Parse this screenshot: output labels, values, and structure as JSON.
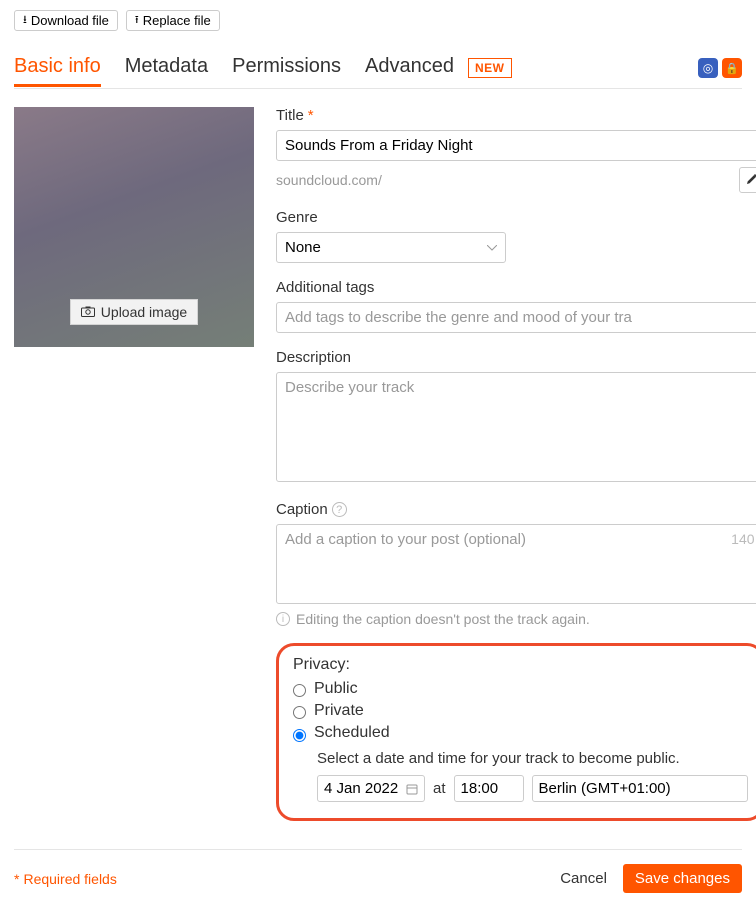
{
  "toolbar": {
    "download": "Download file",
    "replace": "Replace file"
  },
  "tabs": {
    "basic": "Basic info",
    "metadata": "Metadata",
    "permissions": "Permissions",
    "advanced": "Advanced",
    "new_badge": "NEW"
  },
  "artwork": {
    "upload_label": "Upload image"
  },
  "fields": {
    "title_label": "Title",
    "title_value": "Sounds From a Friday Night",
    "url_prefix": "soundcloud.com/",
    "genre_label": "Genre",
    "genre_value": "None",
    "tags_label": "Additional tags",
    "tags_placeholder": "Add tags to describe the genre and mood of your tra",
    "desc_label": "Description",
    "desc_placeholder": "Describe your track",
    "caption_label": "Caption",
    "caption_placeholder": "Add a caption to your post (optional)",
    "caption_count": "140",
    "caption_hint": "Editing the caption doesn't post the track again."
  },
  "privacy": {
    "label": "Privacy:",
    "public": "Public",
    "private": "Private",
    "scheduled": "Scheduled",
    "scheduled_hint": "Select a date and time for your track to become public.",
    "date": "4 Jan 2022",
    "at": "at",
    "time": "18:00",
    "timezone": "Berlin (GMT+01:00)"
  },
  "footer": {
    "required": "Required fields",
    "cancel": "Cancel",
    "save": "Save changes"
  }
}
